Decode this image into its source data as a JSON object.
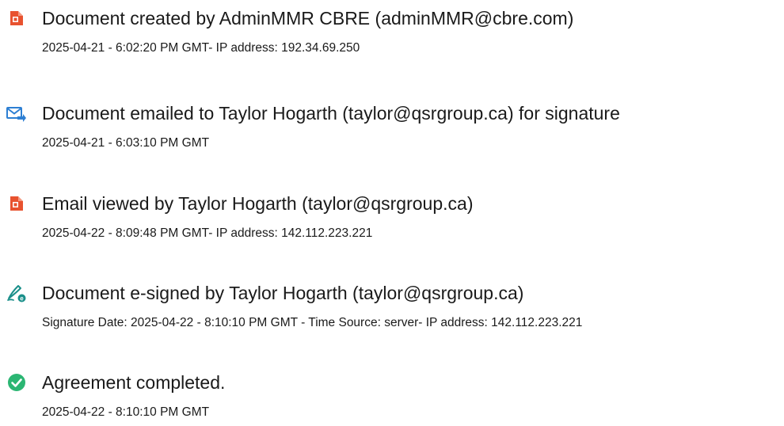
{
  "events": [
    {
      "icon": "document-created-icon",
      "title": "Document created by AdminMMR CBRE (adminMMR@cbre.com)",
      "detail": "2025-04-21 - 6:02:20 PM GMT- IP address: 192.34.69.250"
    },
    {
      "icon": "email-sent-icon",
      "title": "Document emailed to Taylor Hogarth (taylor@qsrgroup.ca) for signature",
      "detail": "2025-04-21 - 6:03:10 PM GMT"
    },
    {
      "icon": "email-viewed-icon",
      "title": "Email viewed by Taylor Hogarth (taylor@qsrgroup.ca)",
      "detail": "2025-04-22 - 8:09:48 PM GMT- IP address: 142.112.223.221"
    },
    {
      "icon": "esign-pen-icon",
      "title": "Document e-signed by Taylor Hogarth (taylor@qsrgroup.ca)",
      "detail": "Signature Date: 2025-04-22 - 8:10:10 PM GMT - Time Source: server- IP address: 142.112.223.221"
    },
    {
      "icon": "check-circle-icon",
      "title": "Agreement completed.",
      "detail": "2025-04-22 - 8:10:10 PM GMT"
    }
  ],
  "colors": {
    "acrobat_red": "#e8522f",
    "email_blue": "#2d7fd3",
    "pen_teal": "#1a8f8a",
    "complete_green": "#2bb673"
  }
}
